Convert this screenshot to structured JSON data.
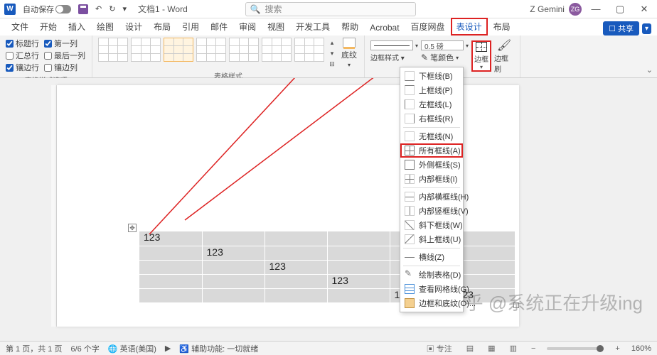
{
  "titlebar": {
    "autosave_label": "自动保存",
    "doc_title": "文档1 - Word",
    "search_placeholder": "搜索",
    "account_name": "Z Gemini",
    "account_initials": "ZG"
  },
  "tabs": {
    "file": "文件",
    "home": "开始",
    "insert": "插入",
    "draw": "绘图",
    "design": "设计",
    "layout": "布局",
    "references": "引用",
    "mailings": "邮件",
    "review": "审阅",
    "view": "视图",
    "devtools": "开发工具",
    "help": "帮助",
    "acrobat": "Acrobat",
    "baidu": "百度网盘",
    "table_design": "表设计",
    "table_layout": "布局",
    "share": "共享"
  },
  "ribbon": {
    "options": {
      "header_row": "标题行",
      "first_col": "第一列",
      "total_row": "汇总行",
      "last_col": "最后一列",
      "banded_rows": "镶边行",
      "banded_cols": "镶边列",
      "group_label": "表格样式选项"
    },
    "styles_group": "表格样式",
    "shading": "底纹",
    "border_style": "边框样式",
    "border_weight": "0.5 磅",
    "pen_color": "笔颜色",
    "border_btn": "边框",
    "border_painter": "边框刷",
    "borders_group": "边框"
  },
  "border_menu": {
    "bottom": "下框线(B)",
    "top": "上框线(P)",
    "left": "左框线(L)",
    "right": "右框线(R)",
    "none": "无框线(N)",
    "all": "所有框线(A)",
    "outside": "外侧框线(S)",
    "inside": "内部框线(I)",
    "inside_h": "内部横框线(H)",
    "inside_v": "内部竖框线(V)",
    "diag_down": "斜下框线(W)",
    "diag_up": "斜上框线(U)",
    "hline": "横线(Z)",
    "draw": "绘制表格(D)",
    "view_grid": "查看网格线(G)",
    "borders_shading": "边框和底纹(O)..."
  },
  "table_cells": {
    "r1c1": "123",
    "r2c2": "123",
    "r3c3": "123",
    "r4c4": "123",
    "r5c5": "123",
    "r5c6": "123"
  },
  "statusbar": {
    "page": "第 1 页，共 1 页",
    "words": "6/6 个字",
    "lang": "英语(美国)",
    "acc": "辅助功能: 一切就绪",
    "focus": "专注",
    "zoom": "160%"
  },
  "watermark": "知乎 @系统正在升级ing"
}
